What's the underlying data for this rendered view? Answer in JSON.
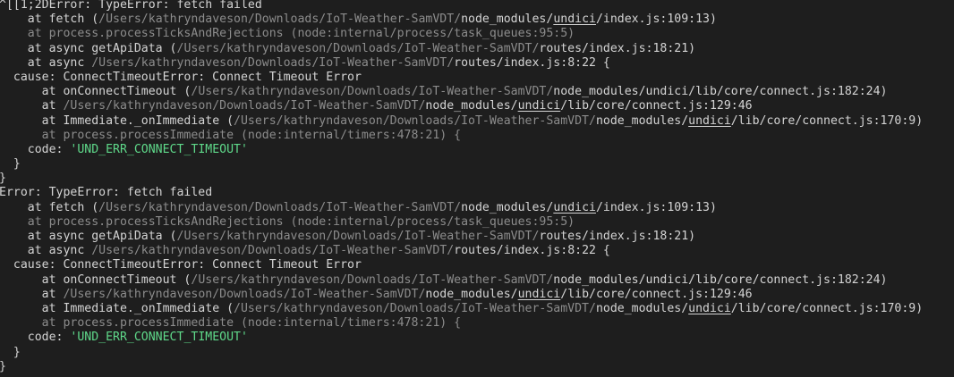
{
  "terminal": {
    "blocks": [
      {
        "header": "^[[1;2DError: TypeError: fetch failed",
        "frames": [
          {
            "indent": "    ",
            "prefix": "at fetch (",
            "path": "/Users/kathryndaveson/Downloads/IoT-Weather-SamVDT/",
            "parts": [
              {
                "t": "node_modules/"
              },
              {
                "t": "undici",
                "u": true
              },
              {
                "t": "/index.js:109:13)"
              }
            ],
            "dim": false
          },
          {
            "indent": "    ",
            "prefix": "at process.processTicksAndRejections (node:internal/process/task_queues:95:5)",
            "path": "",
            "parts": [],
            "dim": true
          },
          {
            "indent": "    ",
            "prefix": "at async getApiData (",
            "path": "/Users/kathryndaveson/Downloads/IoT-Weather-SamVDT/",
            "parts": [
              {
                "t": "routes/index.js:18:21)"
              }
            ],
            "dim": false
          },
          {
            "indent": "    ",
            "prefix": "at async ",
            "path": "/Users/kathryndaveson/Downloads/IoT-Weather-SamVDT/",
            "parts": [
              {
                "t": "routes/index.js:8:22 {"
              }
            ],
            "dim": false
          }
        ],
        "cause": "  cause: ConnectTimeoutError: Connect Timeout Error",
        "cause_frames": [
          {
            "indent": "      ",
            "prefix": "at onConnectTimeout (",
            "path": "/Users/kathryndaveson/Downloads/IoT-Weather-SamVDT/",
            "parts": [
              {
                "t": "node_modules/undici/lib/core/connect.js:182:24)"
              }
            ],
            "dim": false
          },
          {
            "indent": "      ",
            "prefix": "at ",
            "path": "/Users/kathryndaveson/Downloads/IoT-Weather-SamVDT/",
            "parts": [
              {
                "t": "node_modules/"
              },
              {
                "t": "undici",
                "u": true
              },
              {
                "t": "/lib/core/connect.js:129:46"
              }
            ],
            "dim": false
          },
          {
            "indent": "      ",
            "prefix": "at Immediate._onImmediate (",
            "path": "/Users/kathryndaveson/Downloads/IoT-Weather-SamVDT/",
            "parts": [
              {
                "t": "node_modules/"
              },
              {
                "t": "undici",
                "u": true
              },
              {
                "t": "/lib/core/connect.js:170:9)"
              }
            ],
            "dim": false
          },
          {
            "indent": "      ",
            "prefix": "at process.processImmediate (node:internal/timers:478:21) {",
            "path": "",
            "parts": [],
            "dim": true
          }
        ],
        "code_label": "    code: ",
        "code_value": "'UND_ERR_CONNECT_TIMEOUT'",
        "close_inner": "  }",
        "close_outer": "}"
      },
      {
        "header": "Error: TypeError: fetch failed",
        "frames": [
          {
            "indent": "    ",
            "prefix": "at fetch (",
            "path": "/Users/kathryndaveson/Downloads/IoT-Weather-SamVDT/",
            "parts": [
              {
                "t": "node_modules/"
              },
              {
                "t": "undici",
                "u": true
              },
              {
                "t": "/index.js:109:13)"
              }
            ],
            "dim": false
          },
          {
            "indent": "    ",
            "prefix": "at process.processTicksAndRejections (node:internal/process/task_queues:95:5)",
            "path": "",
            "parts": [],
            "dim": true
          },
          {
            "indent": "    ",
            "prefix": "at async getApiData (",
            "path": "/Users/kathryndaveson/Downloads/IoT-Weather-SamVDT/",
            "parts": [
              {
                "t": "routes/index.js:18:21)"
              }
            ],
            "dim": false
          },
          {
            "indent": "    ",
            "prefix": "at async ",
            "path": "/Users/kathryndaveson/Downloads/IoT-Weather-SamVDT/",
            "parts": [
              {
                "t": "routes/index.js:8:22 {"
              }
            ],
            "dim": false
          }
        ],
        "cause": "  cause: ConnectTimeoutError: Connect Timeout Error",
        "cause_frames": [
          {
            "indent": "      ",
            "prefix": "at onConnectTimeout (",
            "path": "/Users/kathryndaveson/Downloads/IoT-Weather-SamVDT/",
            "parts": [
              {
                "t": "node_modules/undici/lib/core/connect.js:182:24)"
              }
            ],
            "dim": false
          },
          {
            "indent": "      ",
            "prefix": "at ",
            "path": "/Users/kathryndaveson/Downloads/IoT-Weather-SamVDT/",
            "parts": [
              {
                "t": "node_modules/"
              },
              {
                "t": "undici",
                "u": true
              },
              {
                "t": "/lib/core/connect.js:129:46"
              }
            ],
            "dim": false
          },
          {
            "indent": "      ",
            "prefix": "at Immediate._onImmediate (",
            "path": "/Users/kathryndaveson/Downloads/IoT-Weather-SamVDT/",
            "parts": [
              {
                "t": "node_modules/"
              },
              {
                "t": "undici",
                "u": true
              },
              {
                "t": "/lib/core/connect.js:170:9)"
              }
            ],
            "dim": false
          },
          {
            "indent": "      ",
            "prefix": "at process.processImmediate (node:internal/timers:478:21) {",
            "path": "",
            "parts": [],
            "dim": true
          }
        ],
        "code_label": "    code: ",
        "code_value": "'UND_ERR_CONNECT_TIMEOUT'",
        "close_inner": "  }",
        "close_outer": "}"
      }
    ]
  },
  "colors": {
    "background": "#1e1e1e",
    "text": "#d4d4d4",
    "dim": "#8c8c8c",
    "string": "#5fd98a"
  }
}
